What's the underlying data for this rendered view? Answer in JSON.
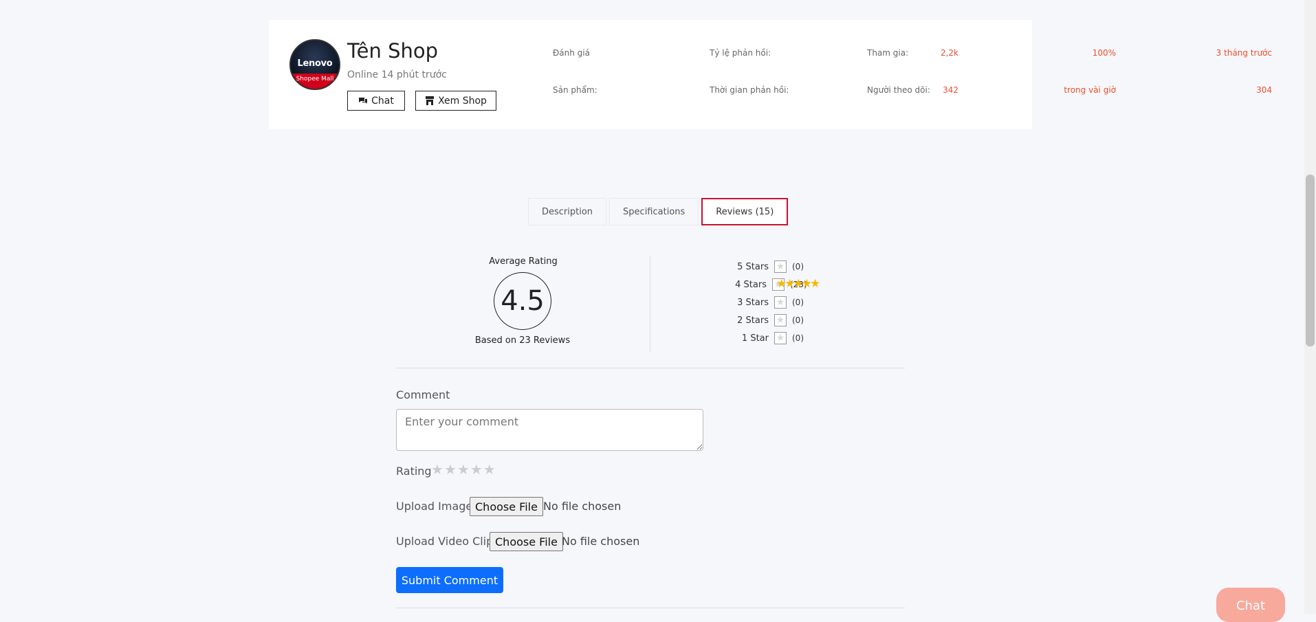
{
  "shop": {
    "name": "Tên Shop",
    "online_status": "Online 14 phút trước",
    "avatar": {
      "logo_text": "Lenovo",
      "band_text": "Shopee Mall"
    },
    "chat_button": "Chat",
    "view_shop_button": "Xem Shop",
    "stats": [
      {
        "label": "Đánh giá",
        "value": "2,2k"
      },
      {
        "label": "Tỷ lệ phản hồi:",
        "value": "100%"
      },
      {
        "label": "Tham gia:",
        "value": "3 tháng trước"
      },
      {
        "label": "Sản phẩm:",
        "value": "342"
      },
      {
        "label": "Thời gian phản hồi:",
        "value": "trong vài giờ"
      },
      {
        "label": "Người theo dõi:",
        "value": "304"
      }
    ]
  },
  "tabs": [
    {
      "label": "Description",
      "active": false
    },
    {
      "label": "Specifications",
      "active": false
    },
    {
      "label": "Reviews (15)",
      "active": true
    }
  ],
  "rating_summary": {
    "title": "Average Rating",
    "average": "4.5",
    "based_on": "Based on 23 Reviews",
    "breakdown": [
      {
        "label": "5 Stars",
        "count": "(0)"
      },
      {
        "label": "4 Stars",
        "count": "(23)"
      },
      {
        "label": "3 Stars",
        "count": "(0)"
      },
      {
        "label": "2 Stars",
        "count": "(0)"
      },
      {
        "label": "1 Star",
        "count": "(0)"
      }
    ]
  },
  "form": {
    "comment_label": "Comment",
    "comment_placeholder": "Enter your comment",
    "rating_label": "Rating",
    "upload_image_label": "Upload Image",
    "upload_video_label": "Upload Video Clip",
    "choose_file": "Choose File",
    "no_file": "No file chosen",
    "submit": "Submit Comment"
  },
  "floating_chat": "Chat",
  "colors": {
    "accent": "#ee4d2d",
    "active_tab_border": "#c8102e",
    "primary_button": "#0d6efd",
    "star": "#f5b800"
  }
}
